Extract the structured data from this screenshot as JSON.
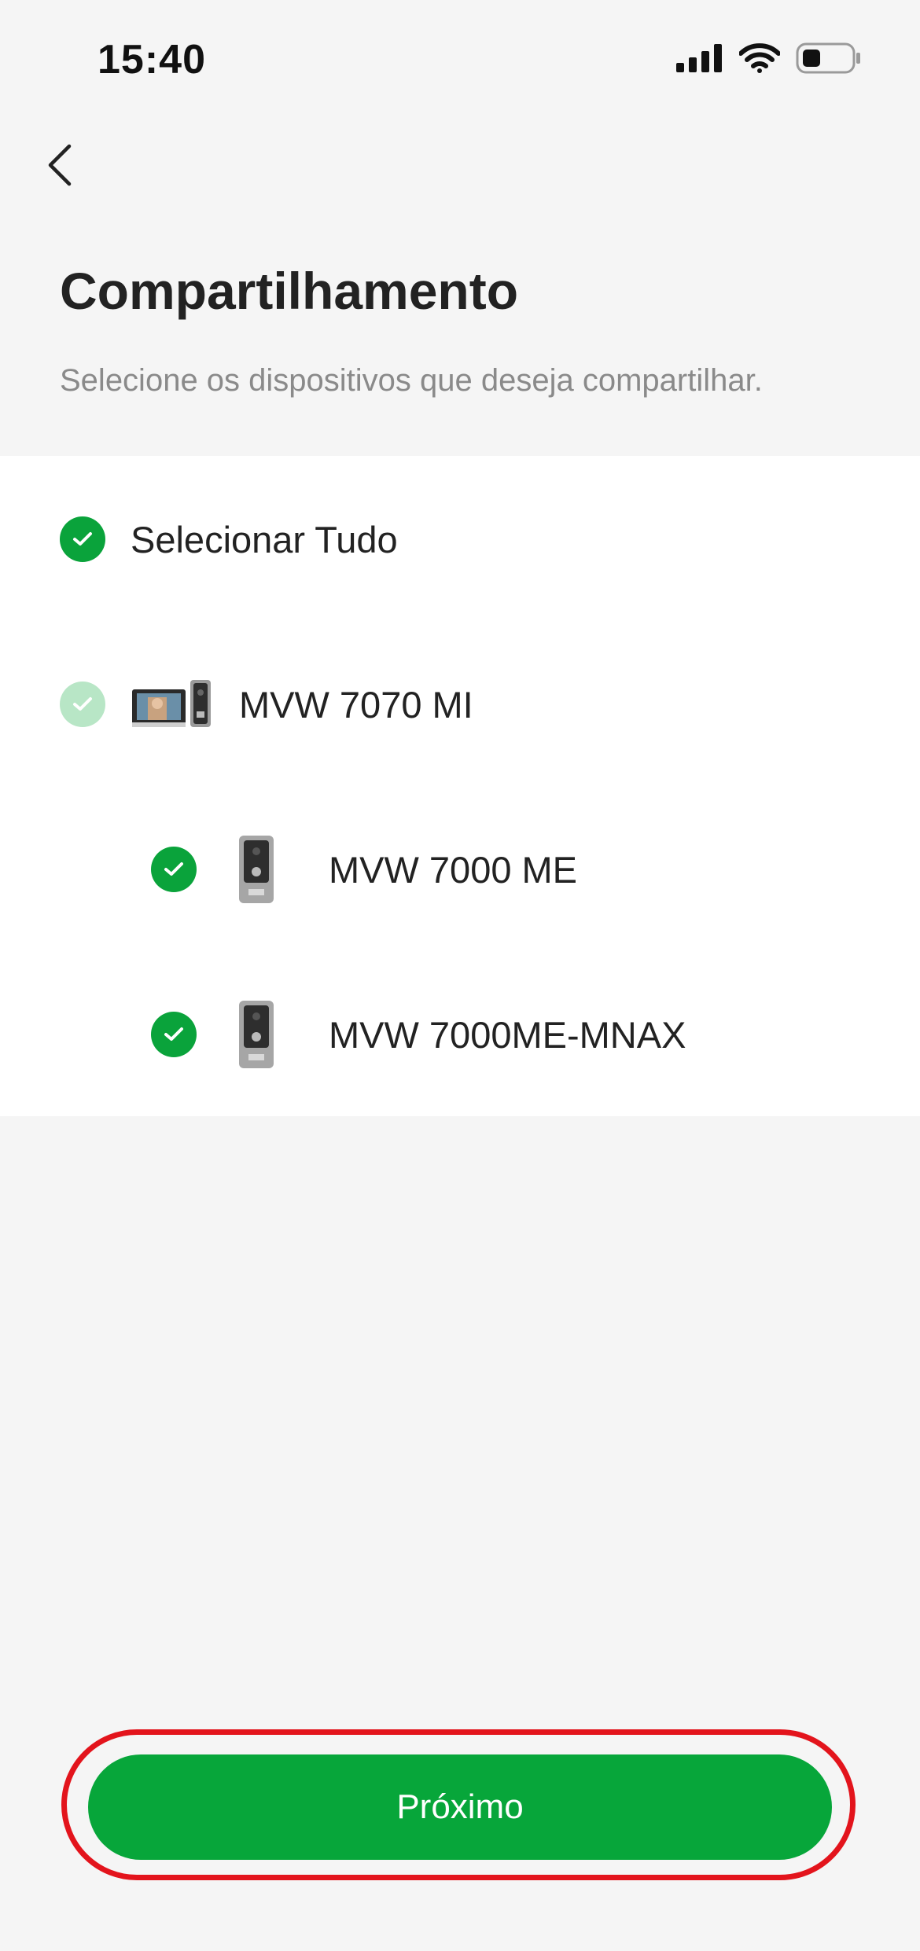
{
  "status_bar": {
    "time": "15:40",
    "icons": [
      "signal-icon",
      "wifi-icon",
      "battery-icon"
    ]
  },
  "header": {
    "back_icon": "chevron-left-icon",
    "title": "Compartilhamento",
    "subtitle": "Selecione os dispositivos que deseja compartilhar."
  },
  "devices": {
    "select_all": {
      "label": "Selecionar Tudo",
      "checked": true
    },
    "items": [
      {
        "label": "MVW 7070 MI",
        "checked": "partial",
        "icon": "monitor-kit-icon"
      },
      {
        "label": "MVW 7000 ME",
        "checked": true,
        "icon": "doorbell-icon"
      },
      {
        "label": "MVW 7000ME-MNAX",
        "checked": true,
        "icon": "doorbell-icon"
      }
    ]
  },
  "footer": {
    "next_label": "Próximo"
  },
  "colors": {
    "accent": "#07a63a",
    "check_partial": "#b8e6c6",
    "highlight": "#e3141c",
    "background": "#f5f5f5"
  }
}
